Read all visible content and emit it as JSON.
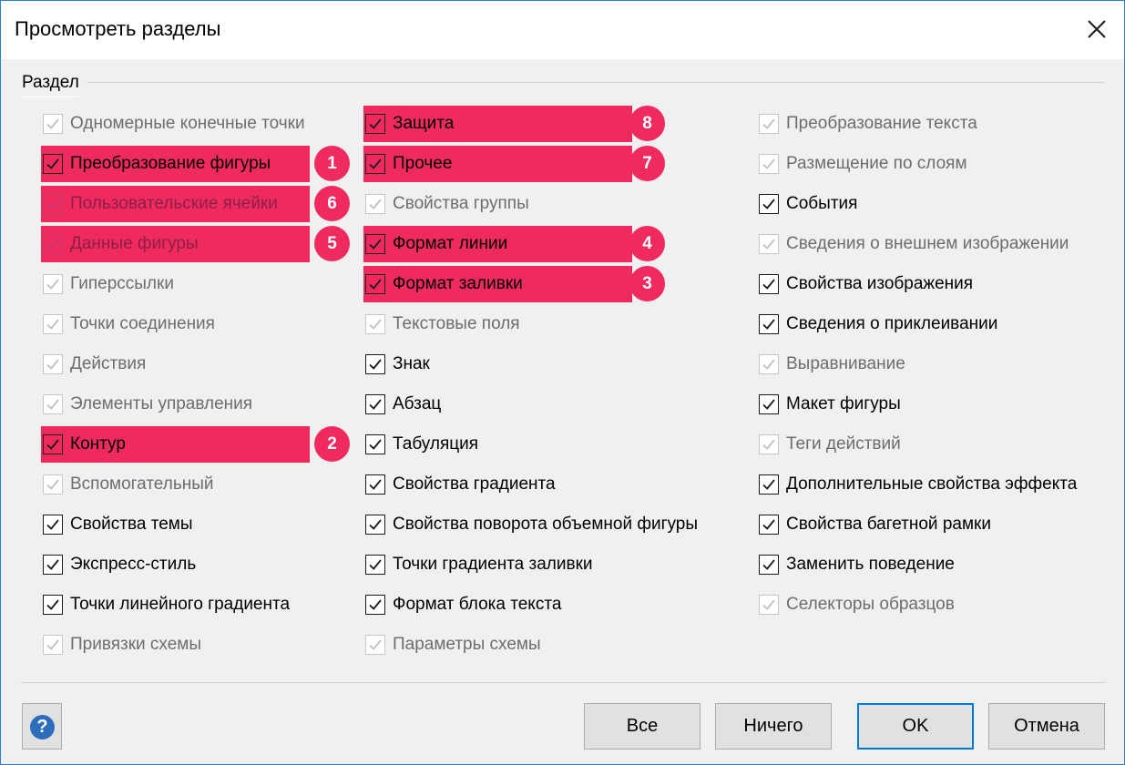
{
  "dialog": {
    "title": "Просмотреть разделы",
    "group_label": "Раздел"
  },
  "colors": {
    "highlight": "#ef2a5f",
    "accent": "#0078d7",
    "help_icon": "#2e6db9"
  },
  "columns": [
    {
      "items": [
        {
          "label": "Одномерные конечные точки",
          "checked": true,
          "disabled": true,
          "highlighted": false,
          "badge": ""
        },
        {
          "label": "Преобразование фигуры",
          "checked": true,
          "disabled": false,
          "highlighted": true,
          "badge": "1"
        },
        {
          "label": "Пользовательские ячейки",
          "checked": true,
          "disabled": true,
          "highlighted": true,
          "badge": "6"
        },
        {
          "label": "Данные фигуры",
          "checked": true,
          "disabled": true,
          "highlighted": true,
          "badge": "5"
        },
        {
          "label": "Гиперссылки",
          "checked": true,
          "disabled": true,
          "highlighted": false,
          "badge": ""
        },
        {
          "label": "Точки соединения",
          "checked": true,
          "disabled": true,
          "highlighted": false,
          "badge": ""
        },
        {
          "label": "Действия",
          "checked": true,
          "disabled": true,
          "highlighted": false,
          "badge": ""
        },
        {
          "label": "Элементы управления",
          "checked": true,
          "disabled": true,
          "highlighted": false,
          "badge": ""
        },
        {
          "label": "Контур",
          "checked": true,
          "disabled": false,
          "highlighted": true,
          "badge": "2"
        },
        {
          "label": "Вспомогательный",
          "checked": true,
          "disabled": true,
          "highlighted": false,
          "badge": ""
        },
        {
          "label": "Свойства темы",
          "checked": true,
          "disabled": false,
          "highlighted": false,
          "badge": ""
        },
        {
          "label": "Экспресс-стиль",
          "checked": true,
          "disabled": false,
          "highlighted": false,
          "badge": ""
        },
        {
          "label": "Точки линейного градиента",
          "checked": true,
          "disabled": false,
          "highlighted": false,
          "badge": ""
        },
        {
          "label": "Привязки схемы",
          "checked": true,
          "disabled": true,
          "highlighted": false,
          "badge": ""
        }
      ]
    },
    {
      "items": [
        {
          "label": "Защита",
          "checked": true,
          "disabled": false,
          "highlighted": true,
          "badge": "8"
        },
        {
          "label": "Прочее",
          "checked": true,
          "disabled": false,
          "highlighted": true,
          "badge": "7"
        },
        {
          "label": "Свойства группы",
          "checked": true,
          "disabled": true,
          "highlighted": false,
          "badge": ""
        },
        {
          "label": "Формат линии",
          "checked": true,
          "disabled": false,
          "highlighted": true,
          "badge": "4"
        },
        {
          "label": "Формат заливки",
          "checked": true,
          "disabled": false,
          "highlighted": true,
          "badge": "3"
        },
        {
          "label": "Текстовые поля",
          "checked": true,
          "disabled": true,
          "highlighted": false,
          "badge": ""
        },
        {
          "label": "Знак",
          "checked": true,
          "disabled": false,
          "highlighted": false,
          "badge": ""
        },
        {
          "label": "Абзац",
          "checked": true,
          "disabled": false,
          "highlighted": false,
          "badge": ""
        },
        {
          "label": "Табуляция",
          "checked": true,
          "disabled": false,
          "highlighted": false,
          "badge": ""
        },
        {
          "label": "Свойства градиента",
          "checked": true,
          "disabled": false,
          "highlighted": false,
          "badge": ""
        },
        {
          "label": "Свойства поворота объемной фигуры",
          "checked": true,
          "disabled": false,
          "highlighted": false,
          "badge": ""
        },
        {
          "label": "Точки градиента заливки",
          "checked": true,
          "disabled": false,
          "highlighted": false,
          "badge": ""
        },
        {
          "label": "Формат блока текста",
          "checked": true,
          "disabled": false,
          "highlighted": false,
          "badge": ""
        },
        {
          "label": "Параметры схемы",
          "checked": true,
          "disabled": true,
          "highlighted": false,
          "badge": ""
        }
      ]
    },
    {
      "items": [
        {
          "label": "Преобразование текста",
          "checked": true,
          "disabled": true,
          "highlighted": false,
          "badge": ""
        },
        {
          "label": "Размещение по слоям",
          "checked": true,
          "disabled": true,
          "highlighted": false,
          "badge": ""
        },
        {
          "label": "События",
          "checked": true,
          "disabled": false,
          "highlighted": false,
          "badge": ""
        },
        {
          "label": "Сведения о внешнем изображении",
          "checked": true,
          "disabled": true,
          "highlighted": false,
          "badge": ""
        },
        {
          "label": "Свойства изображения",
          "checked": true,
          "disabled": false,
          "highlighted": false,
          "badge": ""
        },
        {
          "label": "Сведения о приклеивании",
          "checked": true,
          "disabled": false,
          "highlighted": false,
          "badge": ""
        },
        {
          "label": "Выравнивание",
          "checked": true,
          "disabled": true,
          "highlighted": false,
          "badge": ""
        },
        {
          "label": "Макет фигуры",
          "checked": true,
          "disabled": false,
          "highlighted": false,
          "badge": ""
        },
        {
          "label": "Теги действий",
          "checked": true,
          "disabled": true,
          "highlighted": false,
          "badge": ""
        },
        {
          "label": "Дополнительные свойства эффекта",
          "checked": true,
          "disabled": false,
          "highlighted": false,
          "badge": ""
        },
        {
          "label": "Свойства багетной рамки",
          "checked": true,
          "disabled": false,
          "highlighted": false,
          "badge": ""
        },
        {
          "label": "Заменить поведение",
          "checked": true,
          "disabled": false,
          "highlighted": false,
          "badge": ""
        },
        {
          "label": "Селекторы образцов",
          "checked": true,
          "disabled": true,
          "highlighted": false,
          "badge": ""
        }
      ]
    }
  ],
  "buttons": {
    "help_icon": "question-mark-icon",
    "help_symbol": "?",
    "all": "Все",
    "none": "Ничего",
    "ok": "OK",
    "cancel": "Отмена"
  }
}
